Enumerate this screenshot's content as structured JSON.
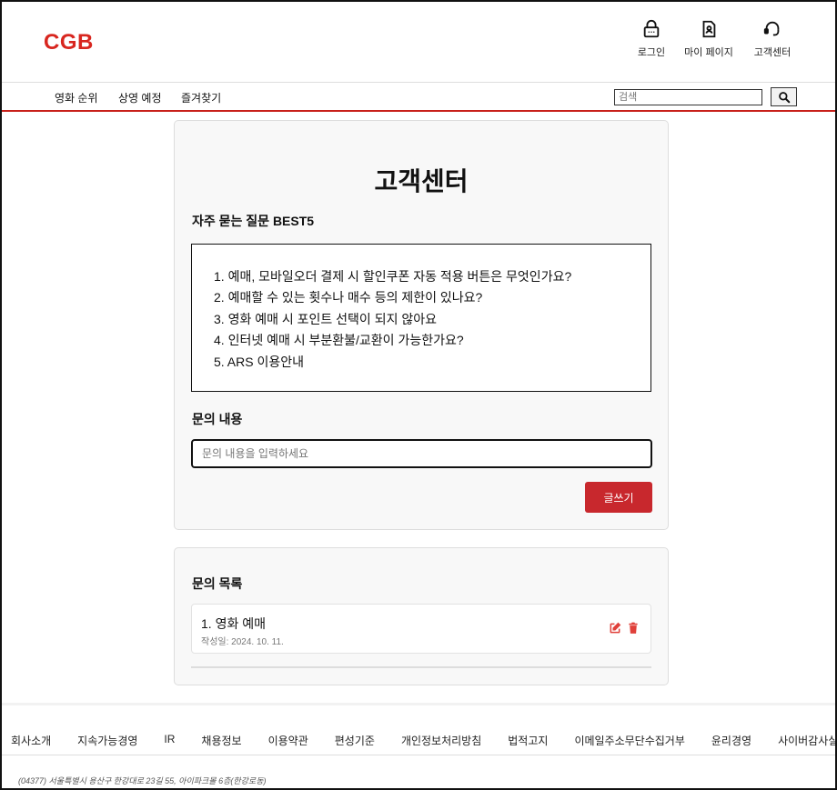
{
  "header": {
    "logo": "CGB",
    "utils": [
      {
        "label": "로그인",
        "icon": "lock-icon"
      },
      {
        "label": "마이 페이지",
        "icon": "profile-document-icon"
      },
      {
        "label": "고객센터",
        "icon": "headset-icon"
      }
    ]
  },
  "nav": {
    "items": [
      "영화 순위",
      "상영 예정",
      "즐겨찾기"
    ],
    "search_placeholder": "검색",
    "search_icon": "search-icon"
  },
  "main": {
    "title": "고객센터",
    "faq_heading": "자주 묻는 질문 BEST5",
    "faq": [
      "1. 예매, 모바일오더 결제 시 할인쿠폰 자동 적용 버튼은 무엇인가요?",
      "2. 예매할 수 있는 횟수나 매수 등의 제한이 있나요?",
      "3. 영화 예매 시 포인트 선택이 되지 않아요",
      "4. 인터넷 예매 시 부분환불/교환이 가능한가요?",
      "5. ARS 이용안내"
    ],
    "inquiry_heading": "문의 내용",
    "inquiry_placeholder": "문의 내용을 입력하세요",
    "submit_label": "글쓰기"
  },
  "inquiry_list": {
    "heading": "문의 목록",
    "items": [
      {
        "title": "1. 영화 예매",
        "date": "작성일: 2024. 10. 11."
      }
    ]
  },
  "footer": {
    "links": [
      "회사소개",
      "지속가능경영",
      "IR",
      "채용정보",
      "이용약관",
      "편성기준",
      "개인정보처리방침",
      "법적고지",
      "이메일주소무단수집거부",
      "윤리경영",
      "사이버감사실"
    ],
    "address": "(04377) 서울특별시 용산구 한강대로 23길 55, 아이파크몰 6층(한강로동)"
  },
  "colors": {
    "brand": "#d8261f",
    "button": "#c8282d",
    "edit_icon": "#e0403a",
    "delete_icon": "#e0403a"
  }
}
